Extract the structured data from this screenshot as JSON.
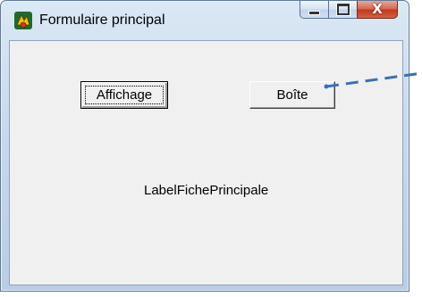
{
  "window": {
    "title": "Formulaire principal",
    "caption": {
      "minimize_icon": "minimize-icon",
      "maximize_icon": "maximize-icon",
      "close_glyph": "X"
    }
  },
  "buttons": {
    "affichage_label": "Affichage",
    "boite_label": "Boîte"
  },
  "labels": {
    "main_label": "LabelFichePrincipale"
  },
  "colors": {
    "client_bg": "#f0f0f0",
    "close_button": "#c2391f",
    "annotation_arrow": "#3a6fb7"
  }
}
